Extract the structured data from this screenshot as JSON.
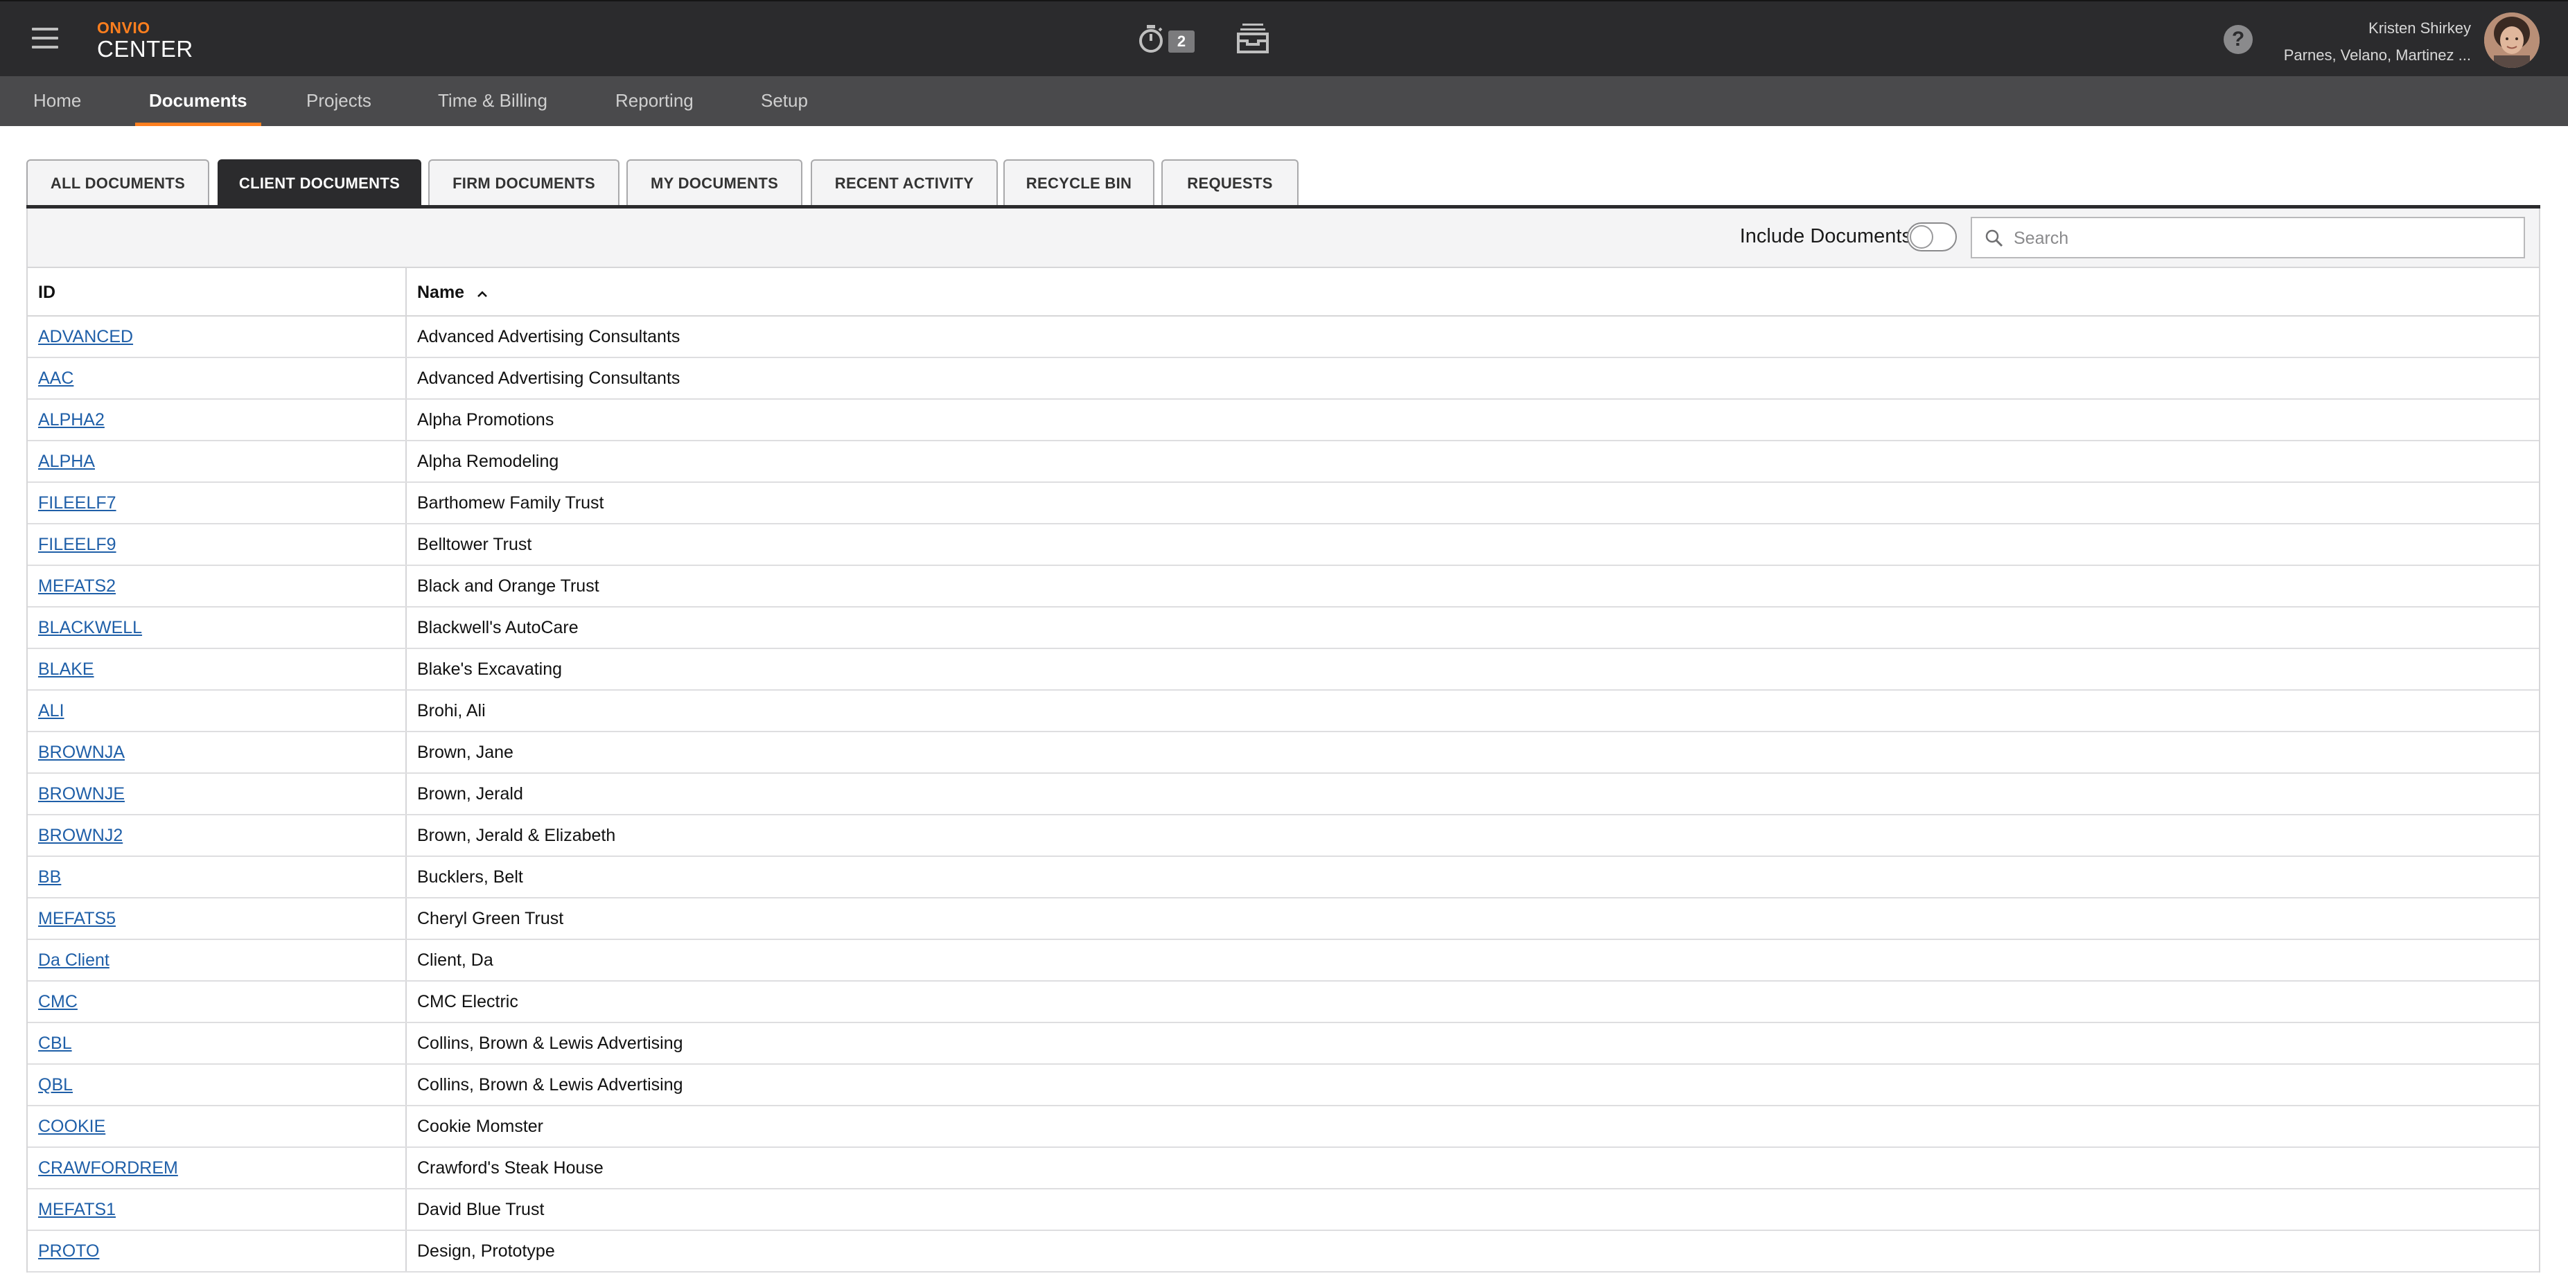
{
  "brand": {
    "top": "ONVIO",
    "bottom": "CENTER"
  },
  "timer": {
    "count": "2"
  },
  "user": {
    "name": "Kristen Shirkey",
    "firm": "Parnes, Velano, Martinez ..."
  },
  "help": {
    "label": "?"
  },
  "nav": [
    {
      "label": "Home",
      "active": false
    },
    {
      "label": "Documents",
      "active": true
    },
    {
      "label": "Projects",
      "active": false
    },
    {
      "label": "Time & Billing",
      "active": false
    },
    {
      "label": "Reporting",
      "active": false
    },
    {
      "label": "Setup",
      "active": false
    }
  ],
  "tabs": [
    {
      "label": "ALL DOCUMENTS",
      "active": false
    },
    {
      "label": "CLIENT DOCUMENTS",
      "active": true
    },
    {
      "label": "FIRM DOCUMENTS",
      "active": false
    },
    {
      "label": "MY DOCUMENTS",
      "active": false
    },
    {
      "label": "RECENT ACTIVITY",
      "active": false
    },
    {
      "label": "RECYCLE BIN",
      "active": false
    },
    {
      "label": "REQUESTS",
      "active": false
    }
  ],
  "toolbar": {
    "include_documents_label": "Include Documents",
    "include_documents_on": false,
    "search_placeholder": "Search"
  },
  "table": {
    "columns": {
      "id": "ID",
      "name": "Name"
    },
    "sort": {
      "column": "name",
      "direction": "ascending"
    },
    "rows": [
      {
        "id": "ADVANCED",
        "name": "Advanced Advertising Consultants"
      },
      {
        "id": "AAC",
        "name": "Advanced Advertising Consultants"
      },
      {
        "id": "ALPHA2",
        "name": "Alpha Promotions"
      },
      {
        "id": "ALPHA",
        "name": "Alpha Remodeling"
      },
      {
        "id": "FILEELF7",
        "name": "Barthomew Family Trust"
      },
      {
        "id": "FILEELF9",
        "name": "Belltower Trust"
      },
      {
        "id": "MEFATS2",
        "name": "Black and Orange Trust"
      },
      {
        "id": "BLACKWELL",
        "name": "Blackwell's AutoCare"
      },
      {
        "id": "BLAKE",
        "name": "Blake's Excavating"
      },
      {
        "id": "ALI",
        "name": "Brohi, Ali"
      },
      {
        "id": "BROWNJA",
        "name": "Brown, Jane"
      },
      {
        "id": "BROWNJE",
        "name": "Brown, Jerald"
      },
      {
        "id": "BROWNJ2",
        "name": "Brown, Jerald & Elizabeth"
      },
      {
        "id": "BB",
        "name": "Bucklers, Belt"
      },
      {
        "id": "MEFATS5",
        "name": "Cheryl Green Trust"
      },
      {
        "id": "Da Client",
        "name": "Client, Da"
      },
      {
        "id": "CMC",
        "name": "CMC Electric"
      },
      {
        "id": "CBL",
        "name": "Collins, Brown & Lewis Advertising"
      },
      {
        "id": "QBL",
        "name": "Collins, Brown & Lewis Advertising"
      },
      {
        "id": "COOKIE",
        "name": "Cookie Momster"
      },
      {
        "id": "CRAWFORDREM",
        "name": "Crawford's Steak House"
      },
      {
        "id": "MEFATS1",
        "name": "David Blue Trust"
      },
      {
        "id": "PROTO",
        "name": "Design, Prototype"
      }
    ]
  },
  "colors": {
    "topbar": "#2b2b2d",
    "navbar": "#4a4a4c",
    "accent": "#ff7f1e",
    "link": "#1f5fa8"
  }
}
